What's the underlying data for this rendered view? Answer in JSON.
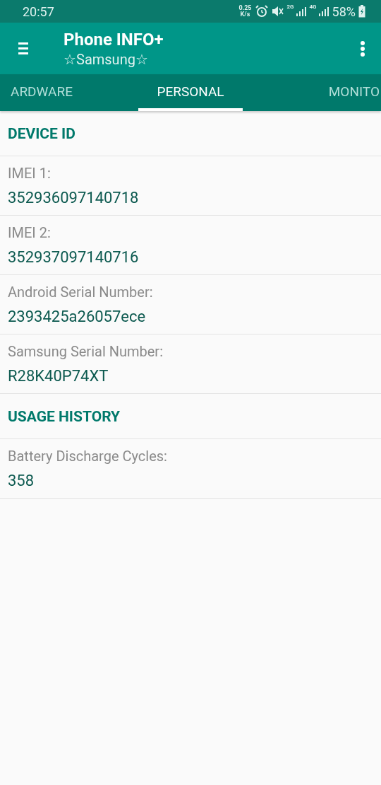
{
  "status_bar": {
    "time": "20:57",
    "speed_value": "0.25",
    "speed_unit": "K/s",
    "network_1": "2G",
    "network_2": "4G",
    "battery": "58%"
  },
  "app_bar": {
    "title": "Phone INFO+",
    "subtitle": "☆Samsung☆"
  },
  "tabs": [
    {
      "label": "ARDWARE",
      "selected": false
    },
    {
      "label": "PERSONAL",
      "selected": true
    },
    {
      "label": "MONITO",
      "selected": false
    }
  ],
  "list": [
    {
      "kind": "section",
      "title": "DEVICE ID"
    },
    {
      "kind": "item",
      "label": "IMEI 1:",
      "value": "352936097140718"
    },
    {
      "kind": "item",
      "label": "IMEI 2:",
      "value": "352937097140716"
    },
    {
      "kind": "item",
      "label": "Android Serial Number:",
      "value": "2393425a26057ece"
    },
    {
      "kind": "item",
      "label": "Samsung Serial Number:",
      "value": "R28K40P74XT"
    },
    {
      "kind": "section",
      "title": "USAGE HISTORY"
    },
    {
      "kind": "item",
      "label": "Battery Discharge Cycles:",
      "value": "358"
    }
  ]
}
